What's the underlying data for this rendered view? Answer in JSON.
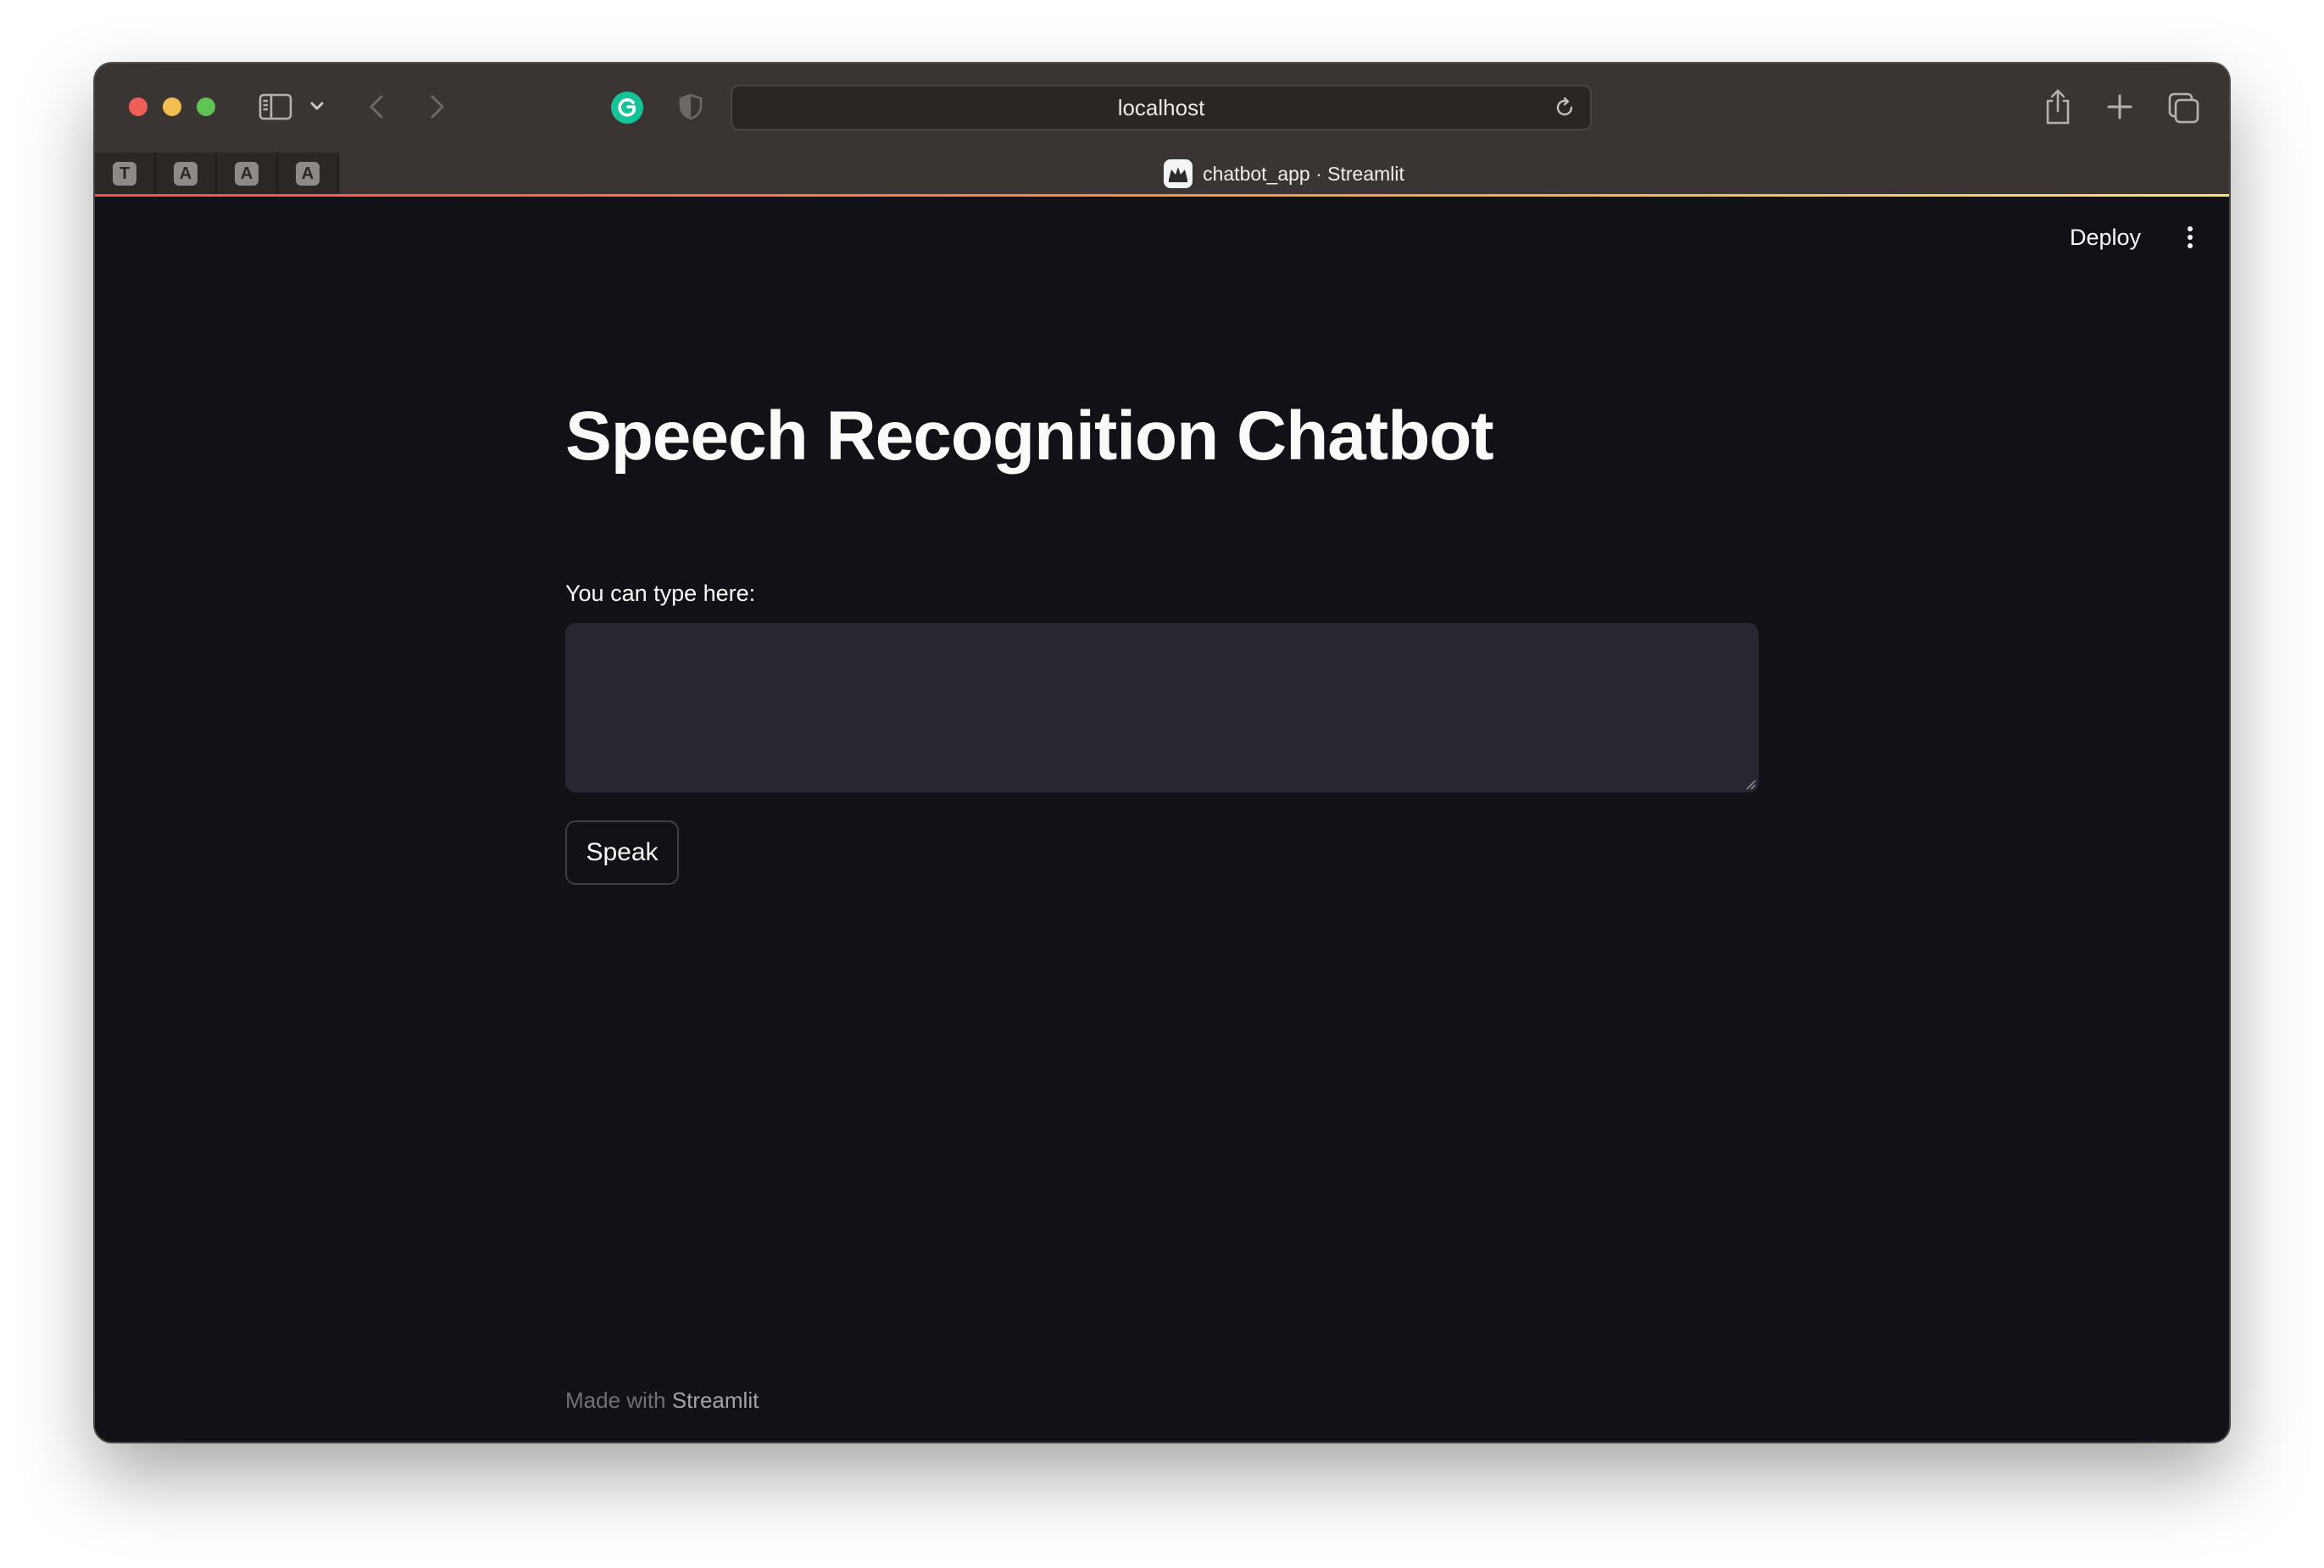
{
  "browser": {
    "url": "localhost",
    "pinned_tabs": [
      "T",
      "A",
      "A",
      "A"
    ],
    "active_tab_title": "chatbot_app · Streamlit"
  },
  "app": {
    "deploy_label": "Deploy",
    "title": "Speech Recognition Chatbot",
    "input_label": "You can type here:",
    "input_value": "",
    "speak_label": "Speak",
    "footer_prefix": "Made with",
    "footer_brand": "Streamlit"
  },
  "colors": {
    "background": "#111217",
    "input_background": "#262730",
    "text": "#fafafa",
    "toolbar": "#3a3533",
    "accent_gradient_start": "#ff4b4b",
    "accent_gradient_end": "#fde26b"
  },
  "icons": {
    "toolbar": [
      "sidebar-icon",
      "chevron-down-icon",
      "back-icon",
      "forward-icon",
      "grammarly-icon",
      "privacy-shield-icon",
      "reload-icon",
      "share-icon",
      "new-tab-icon",
      "tab-overview-icon"
    ],
    "page": [
      "kebab-menu-icon"
    ]
  }
}
